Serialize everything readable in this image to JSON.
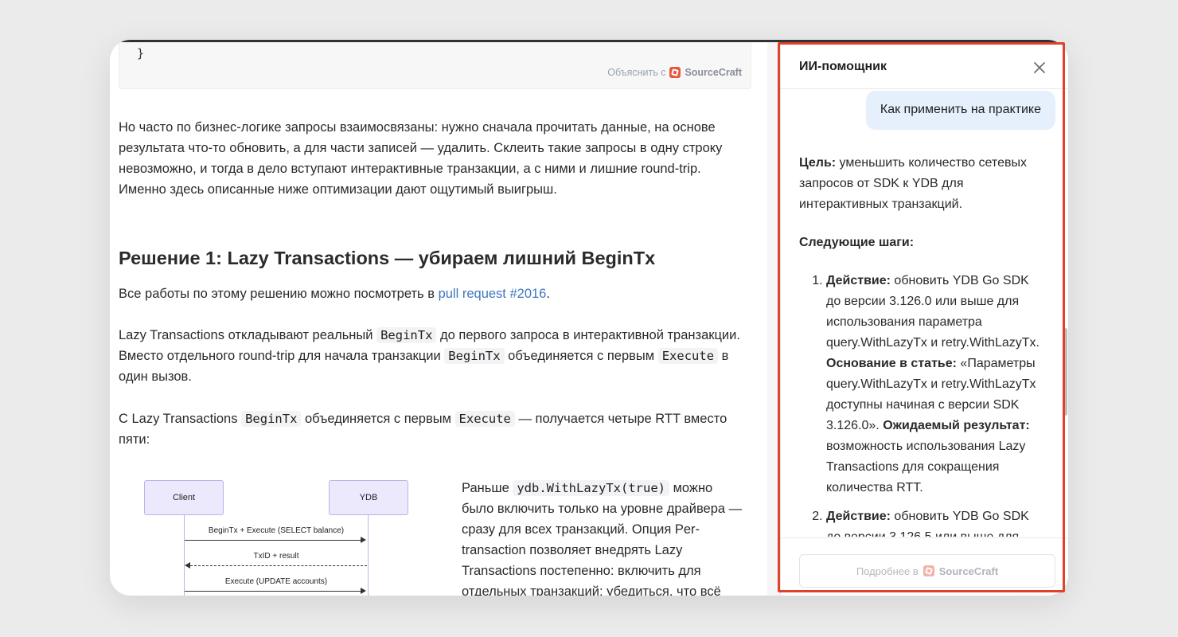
{
  "article": {
    "code_closing": "}",
    "explain_prefix": "Объяснить с",
    "explain_brand": "SourceCraft",
    "para1": "Но часто по бизнес-логике запросы взаимосвязаны: нужно сначала прочитать данные, на основе результата что-то обновить, а для части записей — удалить. Склеить такие запросы в одну строку невозможно, и тогда в дело вступают интерактивные транзакции, а с ними и лишние round-trip. Именно здесь описанные ниже оптимизации дают ощутимый выигрыш.",
    "heading": "Решение 1: Lazy Transactions — убираем лишний BeginTx",
    "para2_prefix": "Все работы по этому решению можно посмотреть в ",
    "para2_link": "pull request #2016",
    "para2_suffix": ".",
    "para3": {
      "t1": "Lazy Transactions откладывают реальный ",
      "c1": "BeginTx",
      "t2": " до первого запроса в интерактивной транзакции. Вместо отдельного round-trip для начала транзакции ",
      "c2": "BeginTx",
      "t3": " объединяется с первым ",
      "c3": "Execute",
      "t4": " в один вызов."
    },
    "para4": {
      "t1": "С Lazy Transactions ",
      "c1": "BeginTx",
      "t2": " объединяется с первым ",
      "c2": "Execute",
      "t3": " — получается четыре RTT вместо пяти:"
    },
    "diagram": {
      "client": "Client",
      "ydb": "YDB",
      "msg1": "BeginTx + Execute (SELECT balance)",
      "msg2": "TxID + result",
      "msg3": "Execute (UPDATE accounts)"
    },
    "side": {
      "t1": "Раньше ",
      "c1": "ydb.WithLazyTx(true)",
      "t2": " можно было включить только на уровне драйвера — сразу для всех транзакций. Опция Per-transaction позволяет внедрять Lazy Transactions постепенно: включить для отдельных транзакций; убедиться, что всё"
    }
  },
  "assistant": {
    "title": "ИИ-помощник",
    "user_message": "Как применить на практике",
    "goal_label": "Цель:",
    "goal_text": " уменьшить количество сетевых запросов от SDK к YDB для интерактивных транзакций.",
    "next_steps": "Следующие шаги:",
    "steps": [
      {
        "action_label": "Действие:",
        "action_text": " обновить YDB Go SDK до версии 3.126.0 или выше для использования параметра query.WithLazyTx и retry.WithLazyTx.",
        "basis_label": "Основание в статье:",
        "basis_text": " «Параметры query.WithLazyTx и retry.WithLazyTx доступны начиная с версии SDK 3.126.0».",
        "result_label": "Ожидаемый результат:",
        "result_text": " возможность использования Lazy Transactions для сокращения количества RTT."
      },
      {
        "action_label": "Действие:",
        "action_text": " обновить YDB Go SDK до версии 3.126.5 или выше для"
      }
    ],
    "more_prefix": "Подробнее в",
    "more_brand": "SourceCraft"
  },
  "colors": {
    "highlight": "#e0412a",
    "link": "#3d77c2",
    "bubble": "#e6f0fc",
    "diagram_node": "#ebe9fb"
  }
}
